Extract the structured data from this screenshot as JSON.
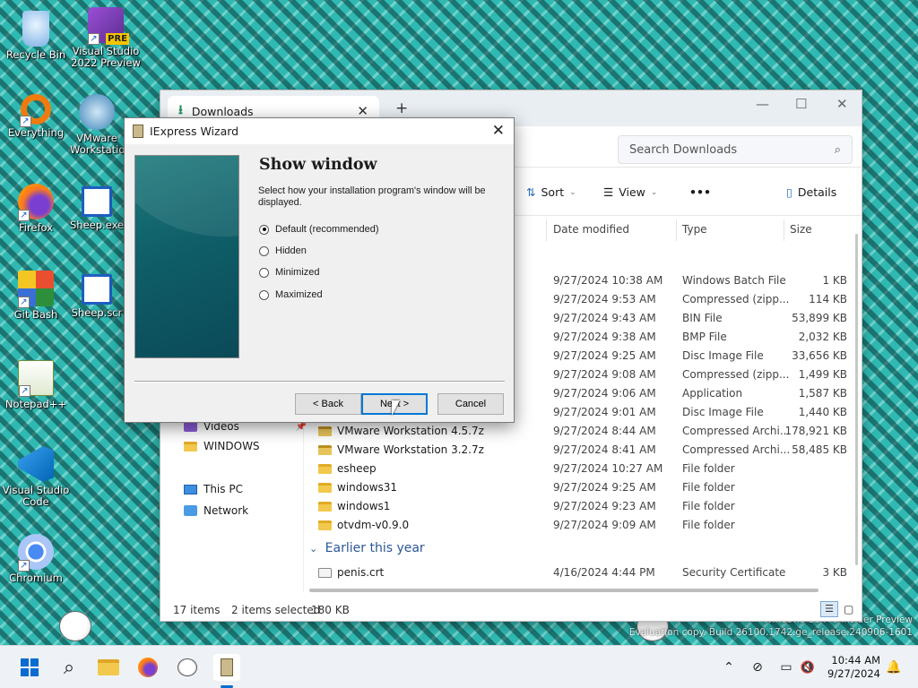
{
  "desktop": {
    "icons": [
      {
        "label": "Recycle Bin"
      },
      {
        "label": "Visual Studio 2022 Preview",
        "badge": "PRE"
      },
      {
        "label": "Everything"
      },
      {
        "label": "VMware Workstation"
      },
      {
        "label": "Firefox"
      },
      {
        "label": "Sheep.exe"
      },
      {
        "label": "Git Bash"
      },
      {
        "label": "Sheep.scr"
      },
      {
        "label": "Notepad++"
      },
      {
        "label": "Visual Studio Code"
      },
      {
        "label": "Chromium"
      }
    ],
    "watermark_line1": "Windows 11 Pro Insider Preview",
    "watermark_line2": "Evaluation copy. Build 26100.1742.ge_release.240906-1601"
  },
  "explorer": {
    "tab_title": "Downloads",
    "search_placeholder": "Search Downloads",
    "toolbar": {
      "sort": "Sort",
      "view": "View",
      "more": "•••",
      "details": "Details"
    },
    "sidebar": {
      "videos": "Videos",
      "windows": "WINDOWS",
      "this_pc": "This PC",
      "network": "Network"
    },
    "columns": {
      "date": "Date modified",
      "type": "Type",
      "size": "Size"
    },
    "rows": [
      {
        "name": "",
        "date": "9/27/2024 10:38 AM",
        "type": "Windows Batch File",
        "size": "1 KB"
      },
      {
        "name": "",
        "date": "9/27/2024 9:53 AM",
        "type": "Compressed (zipp...",
        "size": "114 KB"
      },
      {
        "name": "",
        "date": "9/27/2024 9:43 AM",
        "type": "BIN File",
        "size": "53,899 KB"
      },
      {
        "name": "",
        "date": "9/27/2024 9:38 AM",
        "type": "BMP File",
        "size": "2,032 KB"
      },
      {
        "name": "",
        "date": "9/27/2024 9:25 AM",
        "type": "Disc Image File",
        "size": "33,656 KB"
      },
      {
        "name": "",
        "date": "9/27/2024 9:08 AM",
        "type": "Compressed (zipp...",
        "size": "1,499 KB"
      },
      {
        "name": "",
        "date": "9/27/2024 9:06 AM",
        "type": "Application",
        "size": "1,587 KB"
      },
      {
        "name": "",
        "date": "9/27/2024 9:01 AM",
        "type": "Disc Image File",
        "size": "1,440 KB"
      },
      {
        "name": "VMware Workstation 4.5.7z",
        "date": "9/27/2024 8:44 AM",
        "type": "Compressed Archi...",
        "size": "178,921 KB"
      },
      {
        "name": "VMware Workstation 3.2.7z",
        "date": "9/27/2024 8:41 AM",
        "type": "Compressed Archi...",
        "size": "58,485 KB"
      },
      {
        "name": "esheep",
        "date": "9/27/2024 10:27 AM",
        "type": "File folder",
        "size": ""
      },
      {
        "name": "windows31",
        "date": "9/27/2024 9:25 AM",
        "type": "File folder",
        "size": ""
      },
      {
        "name": "windows1",
        "date": "9/27/2024 9:23 AM",
        "type": "File folder",
        "size": ""
      },
      {
        "name": "otvdm-v0.9.0",
        "date": "9/27/2024 9:09 AM",
        "type": "File folder",
        "size": ""
      }
    ],
    "group_earlier": "Earlier this year",
    "earlier_rows": [
      {
        "name": "penis.crt",
        "date": "4/16/2024 4:44 PM",
        "type": "Security Certificate",
        "size": "3 KB"
      }
    ],
    "status": {
      "items": "17 items",
      "selected": "2 items selected",
      "size": "180 KB"
    }
  },
  "wizard": {
    "title": "IExpress Wizard",
    "heading": "Show window",
    "description": "Select how your installation program's window will be displayed.",
    "options": [
      {
        "label": "Default (recommended)",
        "selected": true
      },
      {
        "label": "Hidden",
        "selected": false
      },
      {
        "label": "Minimized",
        "selected": false
      },
      {
        "label": "Maximized",
        "selected": false
      }
    ],
    "buttons": {
      "back": "< Back",
      "next": "Next >",
      "cancel": "Cancel"
    }
  },
  "taskbar": {
    "time": "10:44 AM",
    "date": "9/27/2024"
  }
}
